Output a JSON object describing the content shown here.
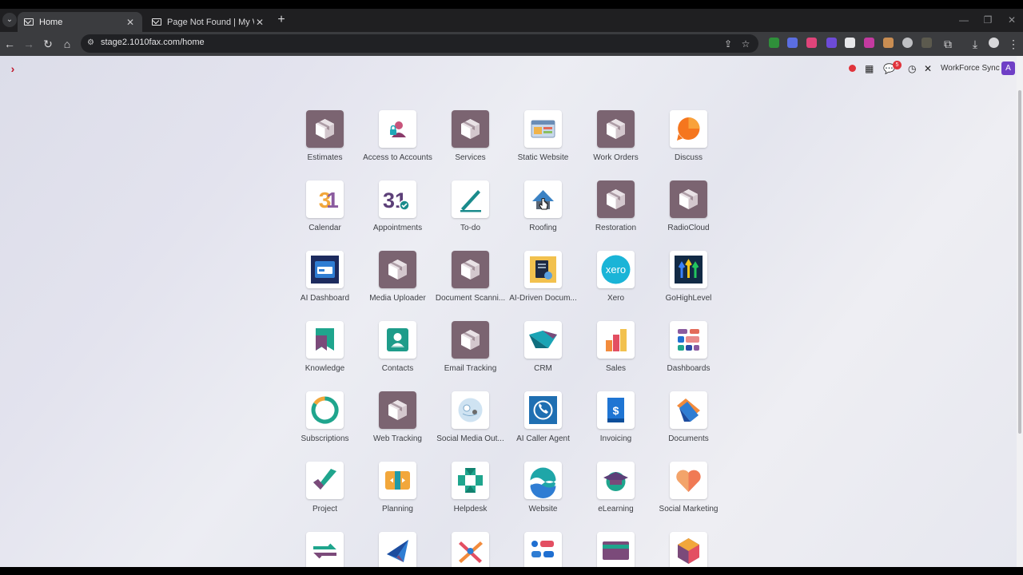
{
  "browser": {
    "tabs": [
      {
        "title": "Home",
        "active": true
      },
      {
        "title": "Page Not Found | My Website",
        "active": false
      }
    ],
    "url": "stage2.1010fax.com/home"
  },
  "systray": {
    "chat_badge": "5",
    "company": "WorkForce Sync",
    "user_initial": "A"
  },
  "apps": [
    {
      "label": "Estimates",
      "icon": "cube-icon"
    },
    {
      "label": "Access to Accounts",
      "icon": "user-lock-icon"
    },
    {
      "label": "Services",
      "icon": "cube-icon"
    },
    {
      "label": "Static Website",
      "icon": "browser-window-icon"
    },
    {
      "label": "Work Orders",
      "icon": "cube-icon"
    },
    {
      "label": "Discuss",
      "icon": "speech-bubble-icon"
    },
    {
      "label": "Calendar",
      "icon": "calendar-31-icon"
    },
    {
      "label": "Appointments",
      "icon": "calendar-check-icon"
    },
    {
      "label": "To-do",
      "icon": "pen-line-icon"
    },
    {
      "label": "Roofing",
      "icon": "house-roof-icon"
    },
    {
      "label": "Restoration",
      "icon": "cube-icon"
    },
    {
      "label": "RadioCloud",
      "icon": "cube-icon"
    },
    {
      "label": "AI Dashboard",
      "icon": "dashboard-window-icon"
    },
    {
      "label": "Media Uploader",
      "icon": "cube-icon"
    },
    {
      "label": "Document Scanni...",
      "icon": "cube-icon"
    },
    {
      "label": "AI-Driven Docum...",
      "icon": "document-ai-icon"
    },
    {
      "label": "Xero",
      "icon": "xero-icon"
    },
    {
      "label": "GoHighLevel",
      "icon": "arrows-up-icon"
    },
    {
      "label": "Knowledge",
      "icon": "bookmark-icon"
    },
    {
      "label": "Contacts",
      "icon": "contact-card-icon"
    },
    {
      "label": "Email Tracking",
      "icon": "cube-icon"
    },
    {
      "label": "CRM",
      "icon": "handshake-icon"
    },
    {
      "label": "Sales",
      "icon": "bar-chart-icon"
    },
    {
      "label": "Dashboards",
      "icon": "tiles-icon"
    },
    {
      "label": "Subscriptions",
      "icon": "refresh-circle-icon"
    },
    {
      "label": "Web Tracking",
      "icon": "cube-icon"
    },
    {
      "label": "Social Media Out...",
      "icon": "social-network-icon"
    },
    {
      "label": "AI Caller Agent",
      "icon": "phone-agent-icon"
    },
    {
      "label": "Invoicing",
      "icon": "invoice-dollar-icon"
    },
    {
      "label": "Documents",
      "icon": "folders-icon"
    },
    {
      "label": "Project",
      "icon": "checkmark-icon"
    },
    {
      "label": "Planning",
      "icon": "planning-icon"
    },
    {
      "label": "Helpdesk",
      "icon": "lifebuoy-icon"
    },
    {
      "label": "Website",
      "icon": "globe-waves-icon"
    },
    {
      "label": "eLearning",
      "icon": "graduation-cap-icon"
    },
    {
      "label": "Social Marketing",
      "icon": "heart-icon"
    },
    {
      "label": "",
      "icon": "switch-arrows-icon"
    },
    {
      "label": "",
      "icon": "paper-plane-icon"
    },
    {
      "label": "",
      "icon": "tools-icon"
    },
    {
      "label": "",
      "icon": "list-blocks-icon"
    },
    {
      "label": "",
      "icon": "credit-card-icon"
    },
    {
      "label": "",
      "icon": "hexagon-cube-icon"
    }
  ]
}
